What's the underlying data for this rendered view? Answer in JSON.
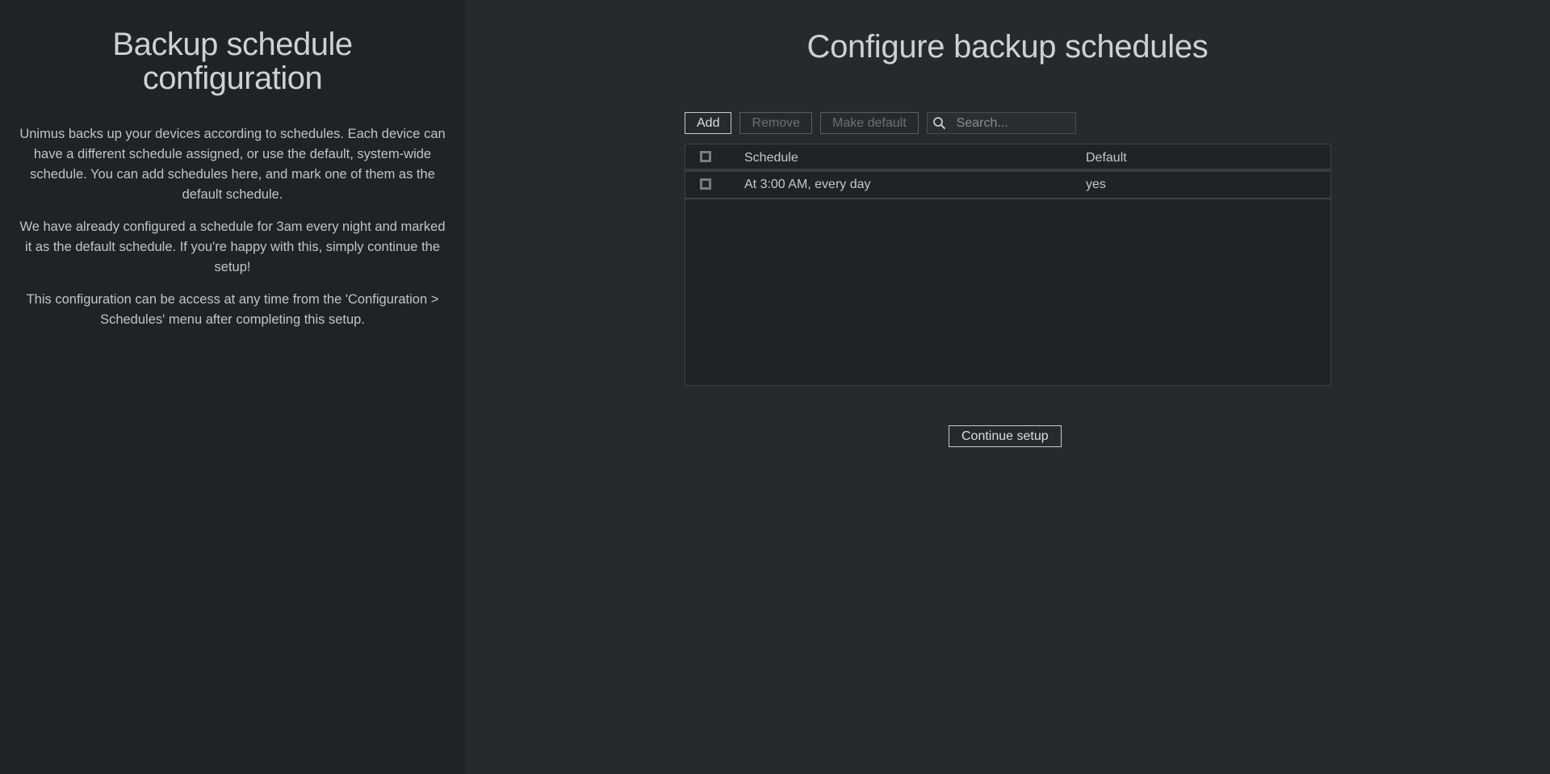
{
  "sidebar": {
    "title": "Backup schedule configuration",
    "paragraphs": [
      "Unimus backs up your devices according to schedules. Each device can have a different schedule assigned, or use the default, system-wide schedule. You can add schedules here, and mark one of them as the default schedule.",
      "We have already configured a schedule for 3am every night and marked it as the default schedule. If you're happy with this, simply continue the setup!",
      "This configuration can be access at any time from the 'Configuration > Schedules' menu after completing this setup."
    ]
  },
  "main": {
    "title": "Configure backup schedules",
    "toolbar": {
      "add_label": "Add",
      "remove_label": "Remove",
      "make_default_label": "Make default",
      "search_placeholder": "Search...",
      "search_icon": "search-icon"
    },
    "table": {
      "columns": [
        "Schedule",
        "Default"
      ],
      "rows": [
        {
          "schedule": "At 3:00 AM, every day",
          "default": "yes",
          "checked": false
        }
      ]
    },
    "continue_label": "Continue setup"
  },
  "colors": {
    "sidebar_bg": "#1f2326",
    "main_bg": "#262a2e",
    "text": "#c8c9ca"
  }
}
